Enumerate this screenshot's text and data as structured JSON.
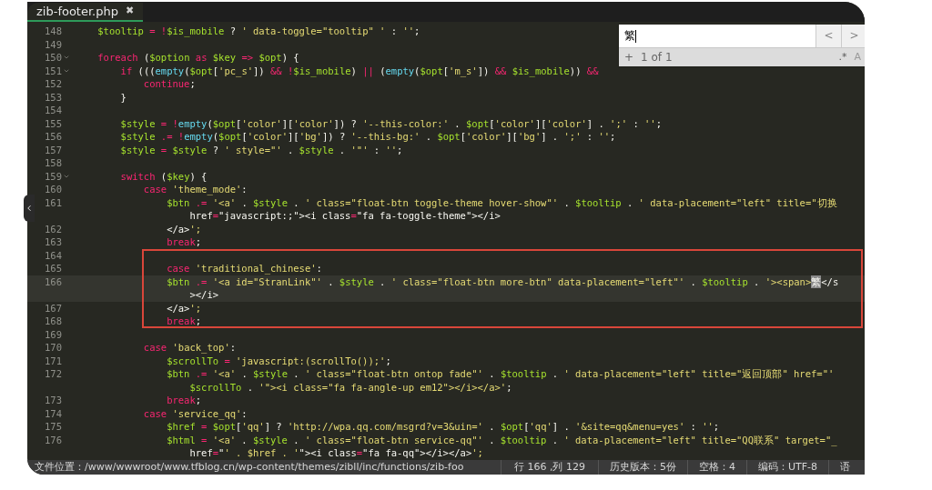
{
  "tab": {
    "title": "zib-footer.php",
    "close": "✖"
  },
  "search": {
    "value": "繁",
    "prev": "<",
    "next": ">",
    "add": "+",
    "count": "1 of 1",
    "regex": ".*",
    "more": "A"
  },
  "lines": [
    {
      "number": "148",
      "text": "    $tooltip = !$is_mobile ? ' data-toggle=\"tooltip\" ' : '';",
      "foldable": false,
      "current": false,
      "boxed": false
    },
    {
      "number": "149",
      "foldable": false,
      "current": false,
      "boxed": false
    },
    {
      "number": "150",
      "text": "    foreach ($option as $key => $opt) {",
      "foldable": true,
      "current": false,
      "boxed": false
    },
    {
      "number": "151",
      "text": "        if (((empty($opt['pc_s']) && !$is_mobile) || (empty($opt['m_s']) && $is_mobile)) &&",
      "foldable": true,
      "current": false,
      "boxed": false
    },
    {
      "number": "152",
      "text": "            continue;",
      "foldable": false,
      "current": false,
      "boxed": false
    },
    {
      "number": "153",
      "text": "        }",
      "foldable": false,
      "current": false,
      "boxed": false
    },
    {
      "number": "154",
      "foldable": false,
      "current": false,
      "boxed": false
    },
    {
      "number": "155",
      "text": "        $style = !empty($opt['color']['color']) ? '--this-color:' . $opt['color']['color'] . ';' : '';",
      "foldable": false,
      "current": false,
      "boxed": false
    },
    {
      "number": "156",
      "text": "        $style .= !empty($opt['color']['bg']) ? '--this-bg:' . $opt['color']['bg'] . ';' : '';",
      "foldable": false,
      "current": false,
      "boxed": false
    },
    {
      "number": "157",
      "text": "        $style = $style ? ' style=\"' . $style . '\"' : '';",
      "foldable": false,
      "current": false,
      "boxed": false
    },
    {
      "number": "158",
      "foldable": false,
      "current": false,
      "boxed": false
    },
    {
      "number": "159",
      "text": "        switch ($key) {",
      "foldable": true,
      "current": false,
      "boxed": false
    },
    {
      "number": "160",
      "text": "            case 'theme_mode':",
      "foldable": false,
      "current": false,
      "boxed": false
    },
    {
      "number": "161",
      "text": "                $btn .= '<a' . $style . ' class=\"float-btn toggle-theme hover-show\"' . $tooltip . ' data-placement=\"left\" title=\"切换",
      "wrapped": "                    href=\"javascript:;\"><i class=\"fa fa-toggle-theme\"></i>",
      "foldable": false,
      "current": false,
      "boxed": false
    },
    {
      "number": "162",
      "text": "                </a>';",
      "foldable": false,
      "current": false,
      "boxed": false
    },
    {
      "number": "163",
      "text": "                break;",
      "foldable": false,
      "current": false,
      "boxed": false
    },
    {
      "number": "164",
      "foldable": false,
      "current": false,
      "boxed": true
    },
    {
      "number": "165",
      "text": "                case 'traditional_chinese':",
      "foldable": false,
      "current": false,
      "boxed": true
    },
    {
      "number": "166",
      "text": "                $btn .= '<a id=\"StranLink\"' . $style . ' class=\"float-btn more-btn\" data-placement=\"left\"' . $tooltip . '><span>",
      "match": "繁",
      "after": "</s",
      "wrapped": "                    ></i>",
      "foldable": false,
      "current": true,
      "boxed": true
    },
    {
      "number": "167",
      "text": "                </a>';",
      "foldable": false,
      "current": false,
      "boxed": true
    },
    {
      "number": "168",
      "text": "                break;",
      "foldable": false,
      "current": false,
      "boxed": true
    },
    {
      "number": "169",
      "foldable": false,
      "current": false,
      "boxed": false
    },
    {
      "number": "170",
      "text": "            case 'back_top':",
      "foldable": false,
      "current": false,
      "boxed": false
    },
    {
      "number": "171",
      "text": "                $scrollTo = 'javascript:(scrollTo());';",
      "foldable": false,
      "current": false,
      "boxed": false
    },
    {
      "number": "172",
      "text": "                $btn .= '<a' . $style . ' class=\"float-btn ontop fade\"' . $tooltip . ' data-placement=\"left\" title=\"返回顶部\" href=\"'",
      "wrapped": "                    $scrollTo . '\"><i class=\"fa fa-angle-up em12\"></i></a>';",
      "foldable": false,
      "current": false,
      "boxed": false
    },
    {
      "number": "173",
      "text": "                break;",
      "foldable": false,
      "current": false,
      "boxed": false
    },
    {
      "number": "174",
      "text": "            case 'service_qq':",
      "foldable": false,
      "current": false,
      "boxed": false
    },
    {
      "number": "175",
      "text": "                $href = $opt['qq'] ? 'http://wpa.qq.com/msgrd?v=3&uin=' . $opt['qq'] . '&site=qq&menu=yes' : '';",
      "foldable": false,
      "current": false,
      "boxed": false
    },
    {
      "number": "176",
      "text": "                $html = '<a' . $style . ' class=\"float-btn service-qq\"' . $tooltip . ' data-placement=\"left\" title=\"QQ联系\" target=\"_",
      "wrapped": "                    href=\"' . $href . '\"><i class=\"fa fa-qq\"></i></a>';",
      "foldable": false,
      "current": false,
      "boxed": false
    }
  ],
  "status_bar": {
    "path": "文件位置：/www/wwwroot/www.tfblog.cn/wp-content/themes/zibll/inc/functions/zib-foo",
    "position": "行 166 ,列 129",
    "history": "历史版本：5份",
    "indent": "空格：4",
    "encoding": "编码：UTF-8",
    "language": "语"
  }
}
